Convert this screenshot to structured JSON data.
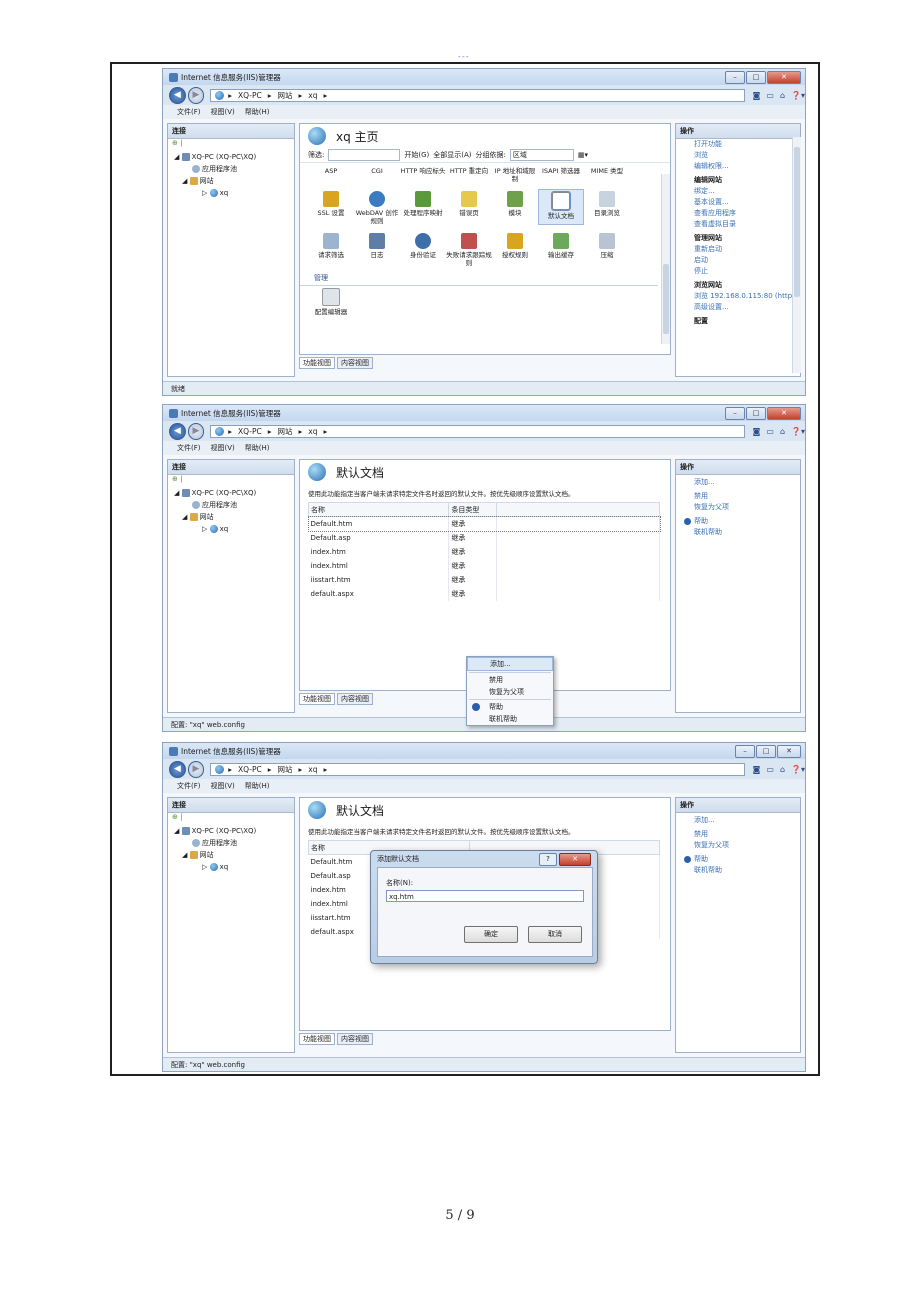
{
  "top_mark": "---",
  "page_number": "5 / 9",
  "windows": [
    {
      "title": "Internet 信息服务(IIS)管理器",
      "address": [
        "XQ-PC",
        "网站",
        "xq"
      ],
      "menu": [
        "文件(F)",
        "视图(V)",
        "帮助(H)"
      ],
      "connections_header": "连接",
      "tree": [
        "XQ-PC (XQ-PC\\XQ)",
        "应用程序池",
        "网站",
        "xq"
      ],
      "main_title": "xq 主页",
      "filter": {
        "label": "筛选:",
        "go": "开始(G)",
        "show_all": "全部显示(A)",
        "group_by": "分组依据:",
        "group_value": "区域"
      },
      "icon_rows": [
        [
          "ASP",
          "CGI",
          "HTTP 响应标头",
          "HTTP 重定向",
          "IP 地址和域限制",
          "ISAPI 筛选器",
          "MIME 类型"
        ],
        [
          "SSL 设置",
          "WebDAV 创作规则",
          "处理程序映射",
          "错误页",
          "模块",
          "默认文档",
          "目录浏览"
        ],
        [
          "请求筛选",
          "日志",
          "身份验证",
          "失败请求跟踪规则",
          "授权规则",
          "输出缓存",
          "压缩"
        ]
      ],
      "section_manage": "管理",
      "manage_items": [
        "配置编辑器"
      ],
      "tabs": [
        "功能视图",
        "内容视图"
      ],
      "actions_header": "操作",
      "actions": [
        {
          "type": "link",
          "text": "打开功能"
        },
        {
          "type": "link",
          "text": "浏览"
        },
        {
          "type": "link",
          "text": "编辑权限..."
        },
        {
          "type": "group",
          "text": "编辑网站"
        },
        {
          "type": "link",
          "text": "绑定..."
        },
        {
          "type": "link",
          "text": "基本设置..."
        },
        {
          "type": "link",
          "text": "查看应用程序"
        },
        {
          "type": "link",
          "text": "查看虚拟目录"
        },
        {
          "type": "group",
          "text": "管理网站"
        },
        {
          "type": "link",
          "text": "重新启动"
        },
        {
          "type": "link",
          "text": "启动"
        },
        {
          "type": "link",
          "text": "停止"
        },
        {
          "type": "group",
          "text": "浏览网站"
        },
        {
          "type": "link",
          "text": "浏览 192.168.0.115:80 (http)"
        },
        {
          "type": "link",
          "text": "高级设置..."
        },
        {
          "type": "group",
          "text": "配置"
        }
      ],
      "status": "就绪"
    },
    {
      "title": "Internet 信息服务(IIS)管理器",
      "address": [
        "XQ-PC",
        "网站",
        "xq"
      ],
      "menu": [
        "文件(F)",
        "视图(V)",
        "帮助(H)"
      ],
      "connections_header": "连接",
      "tree": [
        "XQ-PC (XQ-PC\\XQ)",
        "应用程序池",
        "网站",
        "xq"
      ],
      "main_title": "默认文档",
      "description": "使用此功能指定当客户端未请求特定文件名时返回的默认文件。按优先级顺序设置默认文档。",
      "columns": [
        "名称",
        "条目类型"
      ],
      "rows": [
        [
          "Default.htm",
          "继承"
        ],
        [
          "Default.asp",
          "继承"
        ],
        [
          "index.htm",
          "继承"
        ],
        [
          "index.html",
          "继承"
        ],
        [
          "iisstart.htm",
          "继承"
        ],
        [
          "default.aspx",
          "继承"
        ]
      ],
      "context_menu": [
        "添加...",
        "禁用",
        "恢复为父项",
        "帮助",
        "联机帮助"
      ],
      "tabs": [
        "功能视图",
        "内容视图"
      ],
      "actions_header": "操作",
      "actions": [
        "添加...",
        "禁用",
        "恢复为父项",
        "帮助",
        "联机帮助"
      ],
      "status": "配置: \"xq\" web.config"
    },
    {
      "title": "Internet 信息服务(IIS)管理器",
      "address": [
        "XQ-PC",
        "网站",
        "xq"
      ],
      "menu": [
        "文件(F)",
        "视图(V)",
        "帮助(H)"
      ],
      "connections_header": "连接",
      "tree": [
        "XQ-PC (XQ-PC\\XQ)",
        "应用程序池",
        "网站",
        "xq"
      ],
      "main_title": "默认文档",
      "description": "使用此功能指定当客户端未请求特定文件名时返回的默认文件。按优先级顺序设置默认文档。",
      "columns": [
        "名称"
      ],
      "rows": [
        "Default.htm",
        "Default.asp",
        "index.htm",
        "index.html",
        "iisstart.htm",
        "default.aspx"
      ],
      "dialog": {
        "title": "添加默认文档",
        "label": "名称(N):",
        "value": "xq.htm",
        "ok": "确定",
        "cancel": "取消"
      },
      "tabs": [
        "功能视图",
        "内容视图"
      ],
      "actions_header": "操作",
      "actions": [
        "添加...",
        "禁用",
        "恢复为父项",
        "帮助",
        "联机帮助"
      ],
      "status": "配置: \"xq\" web.config"
    }
  ]
}
